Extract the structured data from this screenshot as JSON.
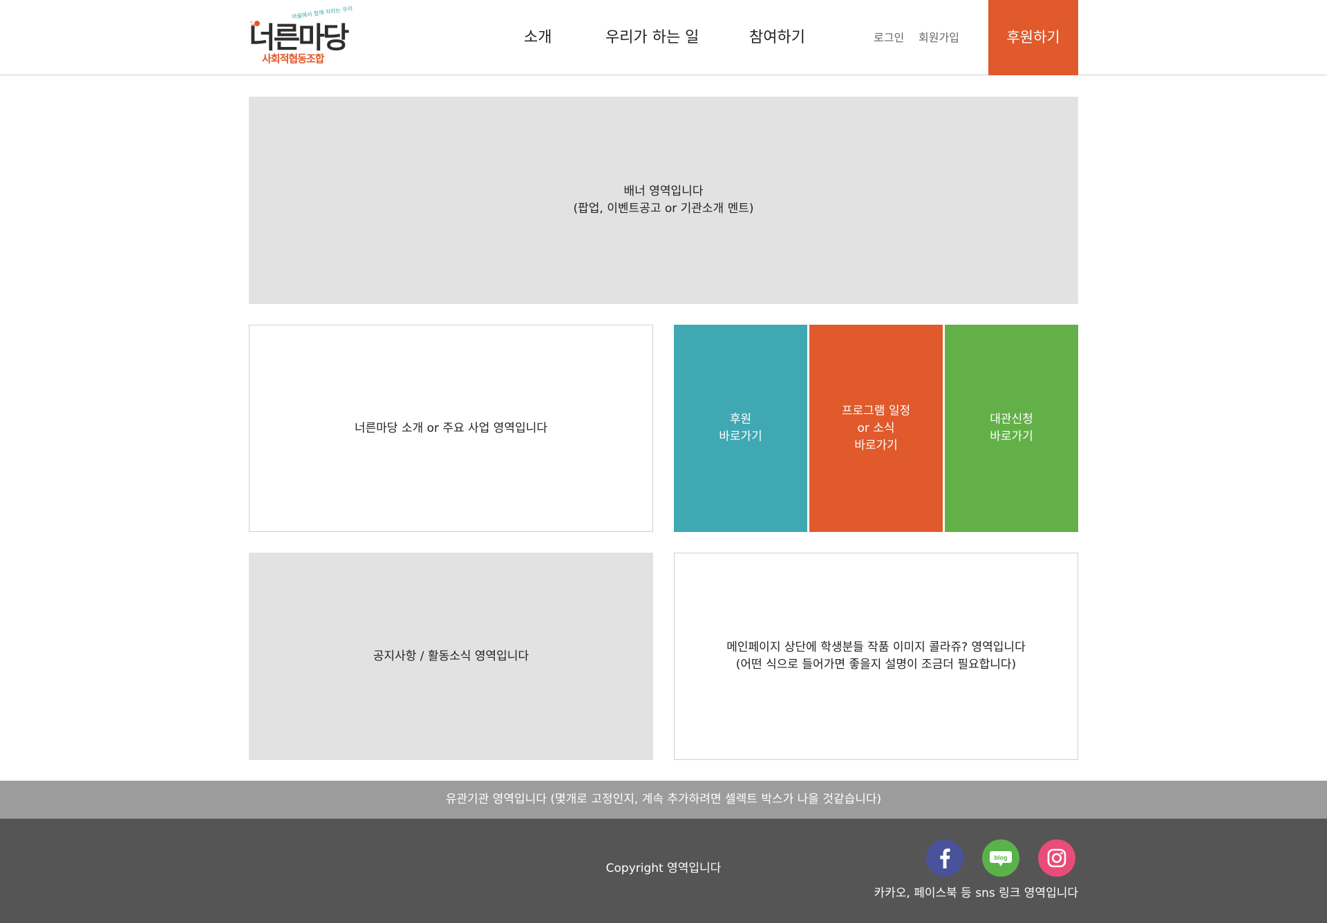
{
  "header": {
    "logo": {
      "tagline": "마을에서 함께 자라는 우리",
      "name": "너른마당",
      "sub": "사회적협동조합"
    },
    "nav": [
      "소개",
      "우리가 하는 일",
      "참여하기"
    ],
    "util": {
      "login": "로그인",
      "join": "회원가입"
    },
    "donate_label": "후원하기"
  },
  "colors": {
    "accent": "#e05a2b",
    "teal": "#3fa8b3",
    "green": "#62b047",
    "placeholder_gray": "#e2e2e2",
    "footer_dark": "#555555",
    "footer_light": "#9c9c9c"
  },
  "main": {
    "banner": {
      "line1": "배너 영역입니다",
      "line2": "(팝업, 이벤트공고 or 기관소개 멘트)"
    },
    "intro": {
      "text": "너른마당 소개 or 주요 사업 영역입니다"
    },
    "quick_links": [
      {
        "line1": "후원",
        "line2": "바로가기",
        "line3": ""
      },
      {
        "line1": "프로그램 일정",
        "line2": "or 소식",
        "line3": "바로가기"
      },
      {
        "line1": "대관신청",
        "line2": "바로가기",
        "line3": ""
      }
    ],
    "notice": {
      "text": "공지사항 / 활동소식 영역입니다"
    },
    "collage": {
      "line1": "메인페이지 상단에 학생분들 작품 이미지 콜라쥬?  영역입니다",
      "line2": "(어떤 식으로 들어가면 좋을지 설명이 조금더 필요합니다)"
    }
  },
  "footer": {
    "related": "유관기관 영역입니다 (몇개로 고정인지, 계속 추가하려면 셀렉트 박스가 나을 것같습니다)",
    "copyright": "Copyright 영역입니다",
    "sns_icons": [
      "facebook-icon",
      "blog-icon",
      "instagram-icon"
    ],
    "sns_label": "카카오, 페이스북 등 sns 링크 영역입니다"
  }
}
